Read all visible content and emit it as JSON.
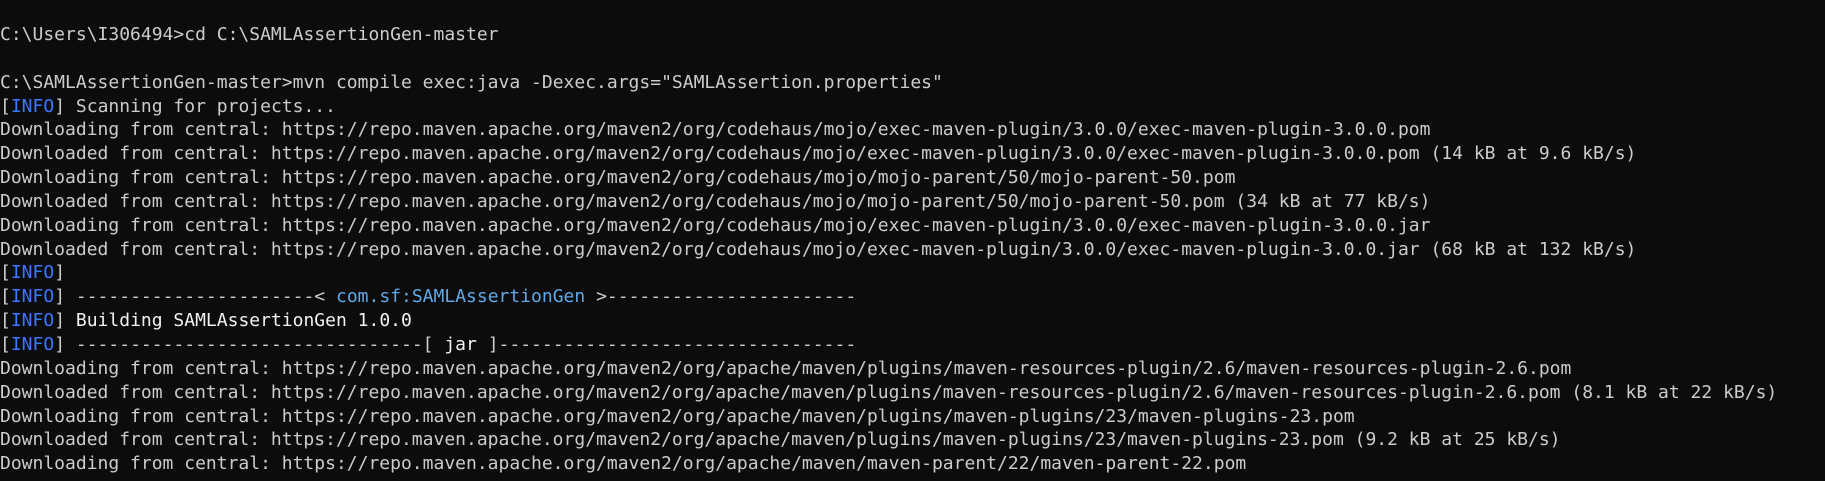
{
  "terminal": {
    "prompt1": {
      "prompt": "C:\\Users\\I306494>",
      "command": "cd C:\\SAMLAssertionGen-master"
    },
    "prompt2": {
      "prompt": "C:\\SAMLAssertionGen-master>",
      "command": "mvn compile exec:java -Dexec.args=\"SAMLAssertion.properties\""
    },
    "info_tag": "INFO",
    "lines": {
      "scanning": "Scanning for projects...",
      "dl1": "Downloading from central: https://repo.maven.apache.org/maven2/org/codehaus/mojo/exec-maven-plugin/3.0.0/exec-maven-plugin-3.0.0.pom",
      "dl2": "Downloaded from central: https://repo.maven.apache.org/maven2/org/codehaus/mojo/exec-maven-plugin/3.0.0/exec-maven-plugin-3.0.0.pom (14 kB at 9.6 kB/s)",
      "dl3": "Downloading from central: https://repo.maven.apache.org/maven2/org/codehaus/mojo/mojo-parent/50/mojo-parent-50.pom",
      "dl4": "Downloaded from central: https://repo.maven.apache.org/maven2/org/codehaus/mojo/mojo-parent/50/mojo-parent-50.pom (34 kB at 77 kB/s)",
      "dl5": "Downloading from central: https://repo.maven.apache.org/maven2/org/codehaus/mojo/exec-maven-plugin/3.0.0/exec-maven-plugin-3.0.0.jar",
      "dl6": "Downloaded from central: https://repo.maven.apache.org/maven2/org/codehaus/mojo/exec-maven-plugin/3.0.0/exec-maven-plugin-3.0.0.jar (68 kB at 132 kB/s)",
      "sep1_left": " ----------------------< ",
      "artifact": "com.sf:SAMLAssertionGen",
      "sep1_right": " >-----------------------",
      "building": " Building SAMLAssertionGen 1.0.0",
      "sep2_left": " --------------------------------[ ",
      "packaging": "jar",
      "sep2_right": " ]---------------------------------",
      "dl7": "Downloading from central: https://repo.maven.apache.org/maven2/org/apache/maven/plugins/maven-resources-plugin/2.6/maven-resources-plugin-2.6.pom",
      "dl8": "Downloaded from central: https://repo.maven.apache.org/maven2/org/apache/maven/plugins/maven-resources-plugin/2.6/maven-resources-plugin-2.6.pom (8.1 kB at 22 kB/s)",
      "dl9": "Downloading from central: https://repo.maven.apache.org/maven2/org/apache/maven/plugins/maven-plugins/23/maven-plugins-23.pom",
      "dl10": "Downloaded from central: https://repo.maven.apache.org/maven2/org/apache/maven/plugins/maven-plugins/23/maven-plugins-23.pom (9.2 kB at 25 kB/s)",
      "dl11": "Downloading from central: https://repo.maven.apache.org/maven2/org/apache/maven/maven-parent/22/maven-parent-22.pom"
    }
  }
}
